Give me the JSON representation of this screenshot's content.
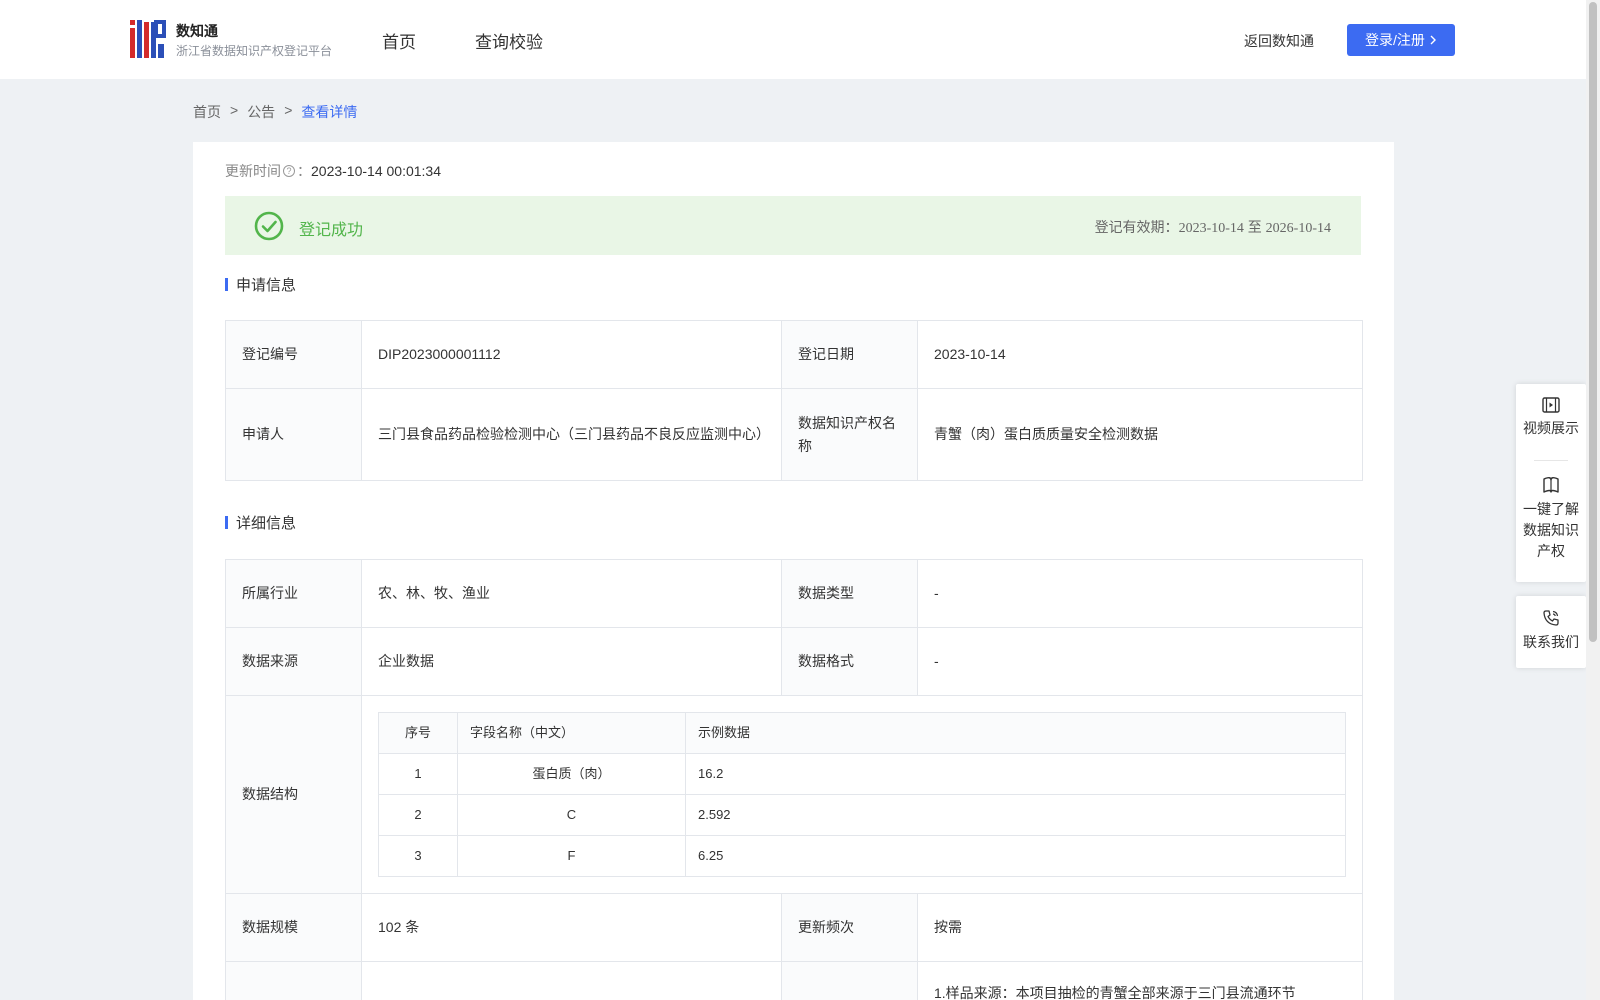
{
  "header": {
    "brand_name": "数知通",
    "brand_sub": "浙江省数据知识产权登记平台",
    "nav": [
      "首页",
      "查询校验"
    ],
    "back_label": "返回数知通",
    "login_label": "登录/注册"
  },
  "breadcrumb": [
    "首页",
    ">",
    "公告",
    ">",
    "查看详情"
  ],
  "update": {
    "label": "更新时间",
    "suffix": "：",
    "value": "2023-10-14 00:01:34"
  },
  "status": {
    "text": "登记成功",
    "validity_label": "登记有效期：",
    "validity_from": "2023-10-14",
    "validity_sep": " 至 ",
    "validity_to": "2026-10-14"
  },
  "apply_section": {
    "title": "申请信息",
    "reg_no_label": "登记编号",
    "reg_no": "DIP2023000001112",
    "reg_date_label": "登记日期",
    "reg_date": "2023-10-14",
    "applicant_label": "申请人",
    "applicant": "三门县食品药品检验检测中心（三门县药品不良反应监测中心）",
    "ip_name_label": "数据知识产权名称",
    "ip_name": "青蟹（肉）蛋白质质量安全检测数据"
  },
  "detail_section": {
    "title": "详细信息",
    "industry_label": "所属行业",
    "industry": "农、林、牧、渔业",
    "data_type_label": "数据类型",
    "data_type": "-",
    "source_label": "数据来源",
    "source": "企业数据",
    "format_label": "数据格式",
    "format": "-",
    "structure_label": "数据结构",
    "structure": {
      "headers": [
        "序号",
        "字段名称（中文）",
        "示例数据"
      ],
      "rows": [
        [
          "1",
          "蛋白质（肉）",
          "16.2"
        ],
        [
          "2",
          "C",
          "2.592"
        ],
        [
          "3",
          "F",
          "6.25"
        ]
      ]
    },
    "scale_label": "数据规模",
    "scale": "102 条",
    "freq_label": "更新频次",
    "freq": "按需",
    "partial_text": "1.样品来源：本项目抽检的青蟹全部来源于三门县流通环节"
  },
  "float_panel": {
    "video": "视频展示",
    "learn": "一键了解数据知识产权",
    "contact": "联系我们"
  },
  "colors": {
    "accent": "#3c6bf2",
    "success": "#52b54b",
    "success_bg": "#e9f6e6"
  }
}
